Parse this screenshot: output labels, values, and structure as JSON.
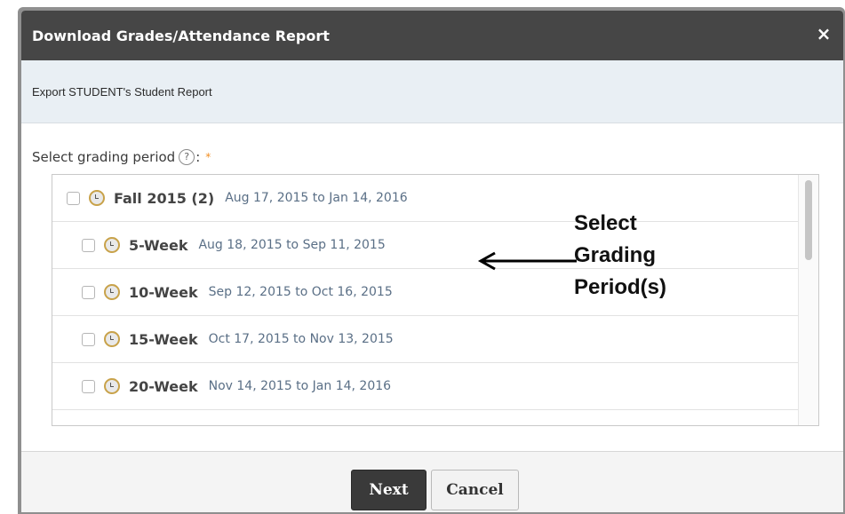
{
  "dialog": {
    "title": "Download Grades/Attendance Report",
    "close_label": "×",
    "subtitle": "Export STUDENT's Student Report",
    "field_label": "Select grading period",
    "help_label": "?",
    "field_suffix": ":",
    "required_marker": "*"
  },
  "periods": [
    {
      "name": "Fall 2015 (2)",
      "dates": "Aug 17, 2015 to Jan 14, 2016"
    },
    {
      "name": "5-Week",
      "dates": "Aug 18, 2015 to Sep 11, 2015"
    },
    {
      "name": "10-Week",
      "dates": "Sep 12, 2015 to Oct 16, 2015"
    },
    {
      "name": "15-Week",
      "dates": "Oct 17, 2015 to Nov 13, 2015"
    },
    {
      "name": "20-Week",
      "dates": "Nov 14, 2015 to Jan 14, 2016"
    }
  ],
  "annotation": {
    "line1": "Select",
    "line2": "Grading",
    "line3": "Period(s)"
  },
  "footer": {
    "next_label": "Next",
    "cancel_label": "Cancel"
  },
  "colors": {
    "titlebar": "#464646",
    "subheader": "#e9eff4",
    "dates_text": "#5a6f86",
    "required": "#f28c1e"
  }
}
